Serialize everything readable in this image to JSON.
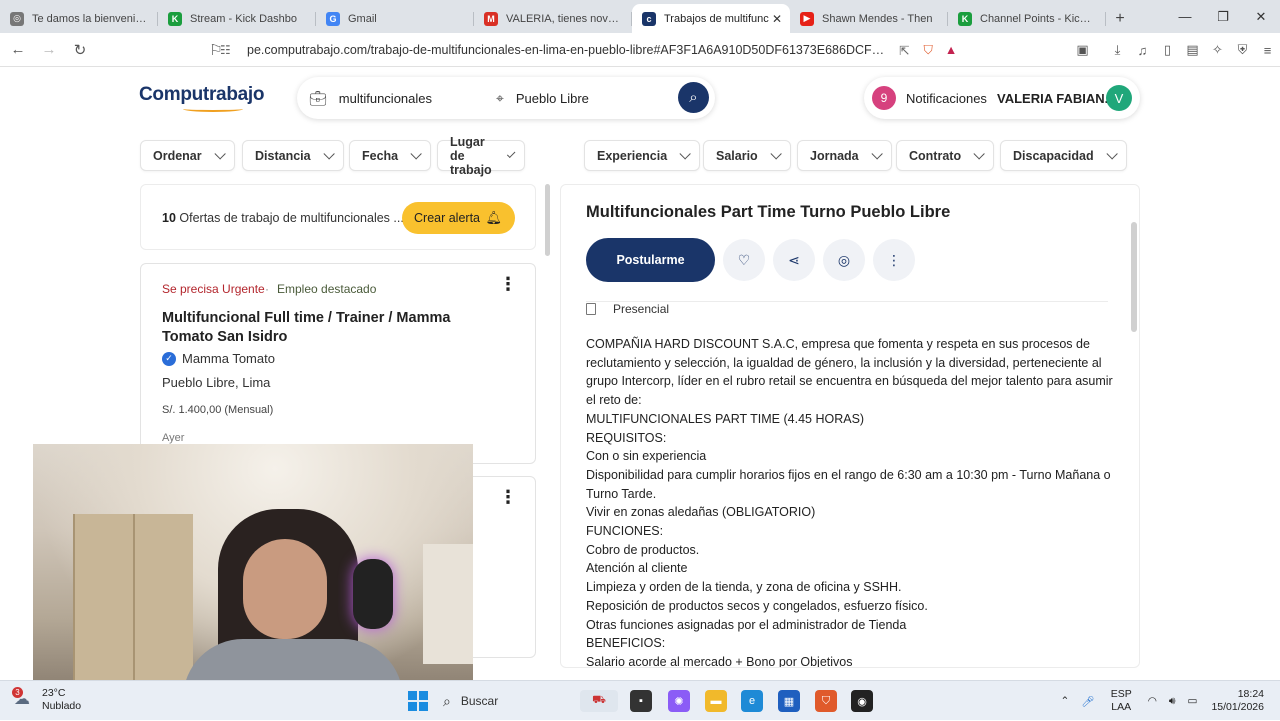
{
  "browser": {
    "tabs": [
      {
        "label": "Te damos la bienvenida a",
        "icon": "globe-icon",
        "color": "#777777",
        "glyph": "◎",
        "active": false
      },
      {
        "label": "Stream - Kick Dashbo",
        "icon": "kick-icon",
        "color": "#1b9e3e",
        "glyph": "K",
        "active": false
      },
      {
        "label": "Gmail",
        "icon": "google-icon",
        "color": "#4285f4",
        "glyph": "G",
        "active": false
      },
      {
        "label": "VALERIA, tienes novedade",
        "icon": "gmail-icon",
        "color": "#d93025",
        "glyph": "M",
        "active": false
      },
      {
        "label": "Trabajos de multifunc",
        "icon": "computrabajo-icon",
        "color": "#1a3569",
        "glyph": "c",
        "active": true
      },
      {
        "label": "Shawn Mendes - Then",
        "icon": "youtube-icon",
        "color": "#e62117",
        "glyph": "▶",
        "active": false
      },
      {
        "label": "Channel Points - Kick Dash",
        "icon": "kick-icon",
        "color": "#1b9e3e",
        "glyph": "K",
        "active": false
      }
    ],
    "url": "pe.computrabajo.com/trabajo-de-multifuncionales-en-lima-en-pueblo-libre#AF3F1A6A910D50DF61373E686DCF3405&lc..."
  },
  "header": {
    "logo": "Computrabajo",
    "search_query": "multifuncionales",
    "search_location": "Pueblo Libre",
    "notifications_count": "9",
    "notifications_label": "Notificaciones",
    "user_name": "VALERIA FABIAN...",
    "user_initial": "V"
  },
  "filters": [
    "Ordenar",
    "Distancia",
    "Fecha",
    "Lugar de trabajo",
    "Experiencia",
    "Salario",
    "Jornada",
    "Contrato",
    "Discapacidad"
  ],
  "results": {
    "count": "10",
    "text": "Ofertas de trabajo de multifuncionales ...",
    "alert_label": "Crear alerta"
  },
  "job_cards": [
    {
      "urgent": "Se precisa Urgente",
      "separator": "·",
      "featured": "Empleo destacado",
      "title": "Multifuncional Full time / Trainer / Mamma Tomato San Isidro",
      "company": "Mamma Tomato",
      "location": "Pueblo Libre, Lima",
      "salary": "S/. 1.400,00 (Mensual)",
      "date": "Ayer"
    }
  ],
  "detail": {
    "title": "Multifuncionales Part Time Turno Pueblo Libre",
    "apply_label": "Postularme",
    "modality": "Presencial",
    "description": [
      "COMPAÑIA HARD DISCOUNT S.A.C, empresa que fomenta y respeta en sus procesos de reclutamiento y selección, la igualdad de género, la inclusión y la diversidad, perteneciente al grupo Intercorp, líder en el rubro retail se encuentra en búsqueda del mejor talento para asumir el reto de:",
      "MULTIFUNCIONALES PART TIME (4.45 HORAS)",
      "REQUISITOS:",
      "Con o sin experiencia",
      "Disponibilidad para cumplir horarios fijos en el rango de 6:30 am a 10:30 pm - Turno Mañana o Turno Tarde.",
      "Vivir en zonas aledañas (OBLIGATORIO)",
      "FUNCIONES:",
      "Cobro de productos.",
      "Atención al cliente",
      "Limpieza y orden de la tienda, y zona de oficina y SSHH.",
      "Reposición de productos secos y congelados, esfuerzo físico.",
      "Otras funciones asignadas por el administrador de Tienda",
      "BENEFICIOS:",
      "Salario acorde al mercado + Bono por Objetivos"
    ]
  },
  "taskbar": {
    "temperature": "23°C",
    "weather": "Nublado",
    "weather_badge": "3",
    "search_label": "Buscar",
    "lang_top": "ESP",
    "lang_bottom": "LAA",
    "time": "18:24",
    "date": "15/01/2026"
  },
  "colors": {
    "brand_navy": "#1a3569",
    "alert_yellow": "#f9c12e",
    "urgent_red": "#b3262d",
    "notif_pink": "#d6417e",
    "avatar_green": "#20a77a"
  }
}
